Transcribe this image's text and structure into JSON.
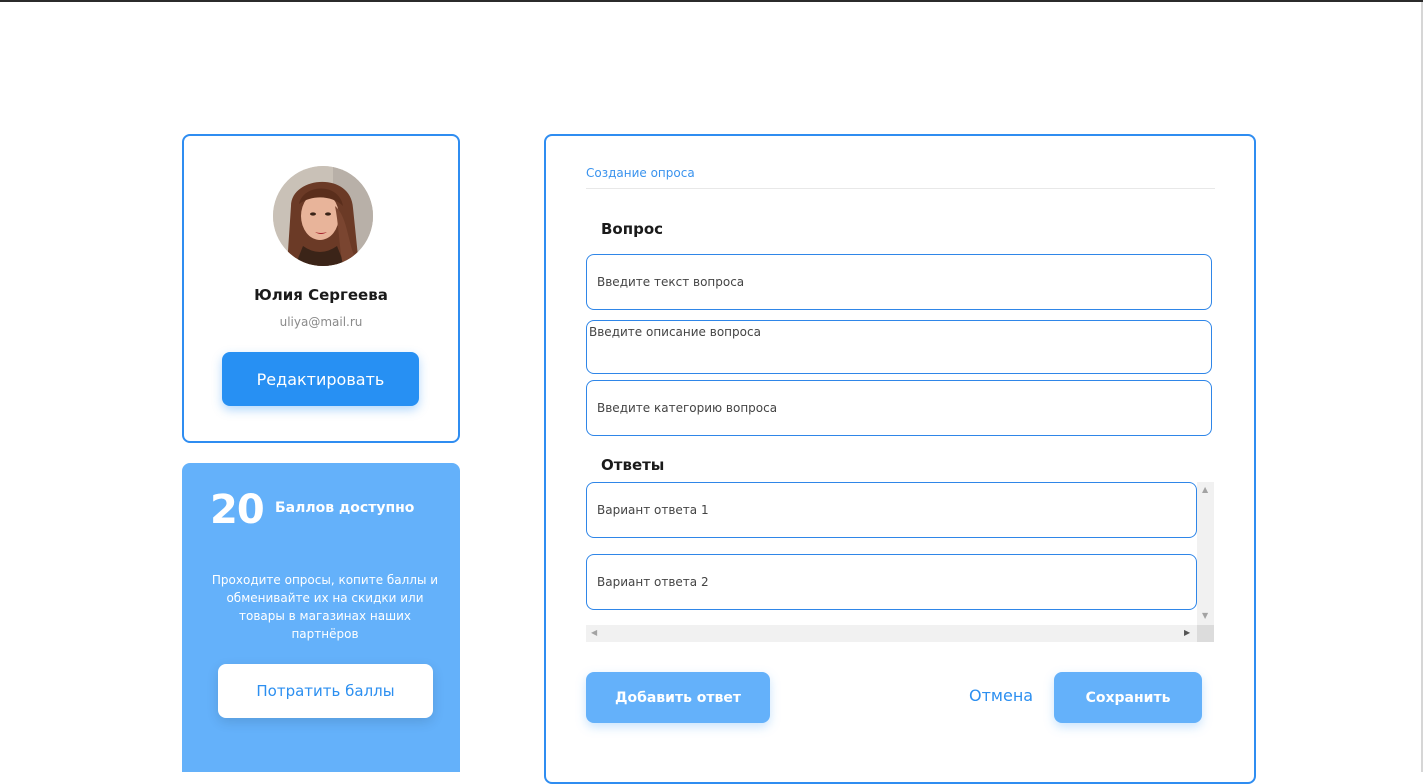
{
  "profile": {
    "name": "Юлия Сергеева",
    "email": "uliya@mail.ru",
    "edit_label": "Редактировать"
  },
  "points": {
    "count": "20",
    "label": "Баллов доступно",
    "description": "Проходите опросы, копите баллы и обменивайте их на скидки или товары в магазинах наших партнёров",
    "spend_label": "Потратить баллы"
  },
  "survey": {
    "title": "Создание опроса",
    "question_section": "Вопрос",
    "question_text_placeholder": "Введите текст вопроса",
    "question_description_placeholder": "Введите описание вопроса",
    "question_category_placeholder": "Введите категорию вопроса",
    "answers_section": "Ответы",
    "answers": [
      {
        "placeholder": "Вариант ответа 1"
      },
      {
        "placeholder": "Вариант ответа 2"
      }
    ],
    "add_answer_label": "Добавить ответ",
    "cancel_label": "Отмена",
    "save_label": "Сохранить"
  },
  "colors": {
    "accent": "#2790f3",
    "accent_light": "#64b1fa",
    "border": "#2f8df1"
  }
}
